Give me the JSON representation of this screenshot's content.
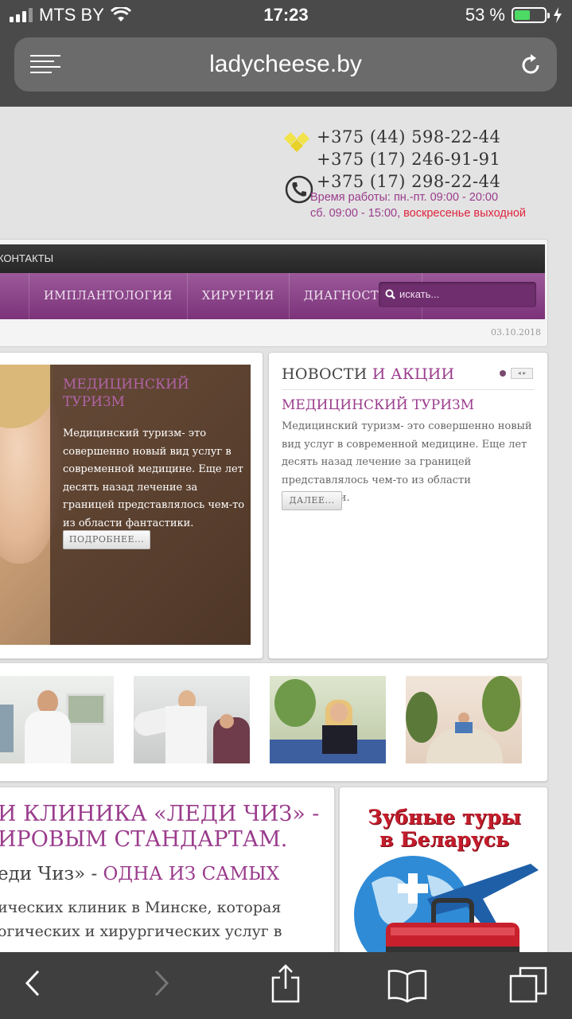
{
  "status": {
    "carrier": "MTS BY",
    "time": "17:23",
    "battery": "53 %",
    "battery_level": 0.53
  },
  "browser": {
    "url": "ladycheese.by"
  },
  "contact": {
    "phones": [
      "+375 (44) 598-22-44",
      "+375 (17) 246-91-91",
      "+375 (17) 298-22-44"
    ],
    "hours_line1": "Время работы: пн.-пт. 09:00 - 20:00",
    "hours_line2_a": "сб. 09:00 - 15:00, ",
    "hours_line2_b": "воскресенье выходной"
  },
  "nav": {
    "top_item": "КОНТАКТЫ",
    "items": [
      "",
      "ИМПЛАНТОЛОГИЯ",
      "ХИРУРГИЯ",
      "ДИАГНОСТИКА"
    ],
    "search_placeholder": "искать...",
    "date": "03.10.2018"
  },
  "slider": {
    "title": "МЕДИЦИНСКИЙ ТУРИЗМ",
    "text": "Медицинский туризм- это совершенно новый вид услуг в современной медицине. Еще лет десять назад лечение за границей представлялось чем-то из области фантастики.",
    "button": "ПОДРОБНЕЕ..."
  },
  "news": {
    "heading_a": "НОВОСТИ",
    "heading_b": " И АКЦИИ",
    "item_title": "МЕДИЦИНСКИЙ ТУРИЗМ",
    "item_text": "Медицинский туризм- это совершенно новый вид услуг в современной медицине. Еще лет десять назад лечение за границей представлялось чем-то из области фантастики.",
    "button": "ДАЛЕЕ...",
    "arrows": "◂ ▸"
  },
  "about": {
    "heading_line1": "И КЛИНИКА «ЛЕДИ ЧИЗ» -",
    "heading_line2": "ИРОВЫМ СТАНДАРТАМ.",
    "sub_a": "еди Чиз» - ",
    "sub_b": "ОДНА ИЗ САМЫХ",
    "p_line1": "ических клиник в Минске, которая",
    "p_line2": "огических и хирургических услуг в"
  },
  "promo": {
    "title_line1": "Зубные туры",
    "title_line2": "в Беларусь"
  }
}
